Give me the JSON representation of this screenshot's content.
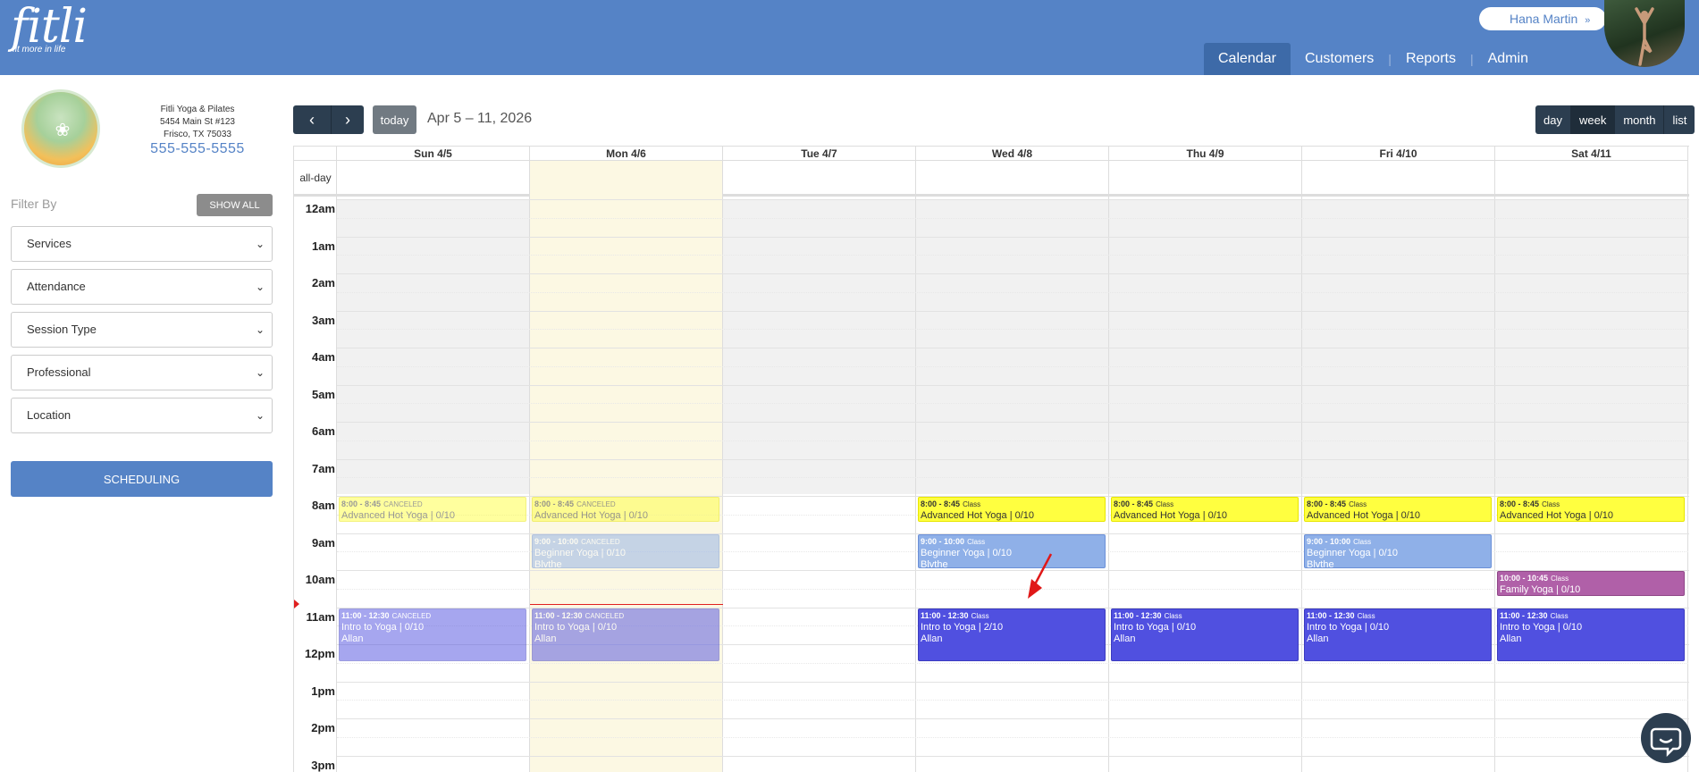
{
  "brand": {
    "logo": "fitli",
    "tagline": "fit more in life"
  },
  "user": {
    "name": "Hana Martin"
  },
  "nav": {
    "calendar": "Calendar",
    "customers": "Customers",
    "reports": "Reports",
    "admin": "Admin",
    "sep": "|"
  },
  "studio": {
    "name": "Fitli Yoga & Pilates",
    "address1": "5454 Main St #123",
    "address2": "Frisco, TX 75033",
    "phone": "555-555-5555"
  },
  "filters": {
    "label": "Filter By",
    "show_all": "SHOW ALL",
    "selects": [
      "Services",
      "Attendance",
      "Session Type",
      "Professional",
      "Location"
    ],
    "scheduling": "SCHEDULING"
  },
  "toolbar": {
    "prev": "‹",
    "next": "›",
    "today": "today",
    "range": "Apr 5 – 11, 2026",
    "views": [
      "day",
      "week",
      "month",
      "list"
    ],
    "active_view": "week"
  },
  "calendar": {
    "allday_label": "all-day",
    "days": [
      "Sun 4/5",
      "Mon 4/6",
      "Tue 4/7",
      "Wed 4/8",
      "Thu 4/9",
      "Fri 4/10",
      "Sat 4/11"
    ],
    "today_index": 1,
    "hours": [
      "12am",
      "1am",
      "2am",
      "3am",
      "4am",
      "5am",
      "6am",
      "7am",
      "8am",
      "9am",
      "10am",
      "11am",
      "12pm",
      "1pm",
      "2pm",
      "3pm"
    ],
    "events": [
      {
        "day": 0,
        "start": 8,
        "end": 8.75,
        "time": "8:00 - 8:45",
        "tag": "CANCELED",
        "title": "Advanced Hot Yoga | 0/10",
        "instructor": "",
        "color": "yellow",
        "canceled": true
      },
      {
        "day": 1,
        "start": 8,
        "end": 8.75,
        "time": "8:00 - 8:45",
        "tag": "CANCELED",
        "title": "Advanced Hot Yoga | 0/10",
        "instructor": "",
        "color": "yellow",
        "canceled": true
      },
      {
        "day": 3,
        "start": 8,
        "end": 8.75,
        "time": "8:00 - 8:45",
        "tag": "Class",
        "title": "Advanced Hot Yoga | 0/10",
        "instructor": "",
        "color": "yellow",
        "canceled": false
      },
      {
        "day": 4,
        "start": 8,
        "end": 8.75,
        "time": "8:00 - 8:45",
        "tag": "Class",
        "title": "Advanced Hot Yoga | 0/10",
        "instructor": "",
        "color": "yellow",
        "canceled": false
      },
      {
        "day": 5,
        "start": 8,
        "end": 8.75,
        "time": "8:00 - 8:45",
        "tag": "Class",
        "title": "Advanced Hot Yoga | 0/10",
        "instructor": "",
        "color": "yellow",
        "canceled": false
      },
      {
        "day": 6,
        "start": 8,
        "end": 8.75,
        "time": "8:00 - 8:45",
        "tag": "Class",
        "title": "Advanced Hot Yoga | 0/10",
        "instructor": "",
        "color": "yellow",
        "canceled": false
      },
      {
        "day": 1,
        "start": 9,
        "end": 10,
        "time": "9:00 - 10:00",
        "tag": "CANCELED",
        "title": "Beginner Yoga | 0/10",
        "instructor": "Blythe",
        "color": "blue",
        "canceled": true
      },
      {
        "day": 3,
        "start": 9,
        "end": 10,
        "time": "9:00 - 10:00",
        "tag": "Class",
        "title": "Beginner Yoga | 0/10",
        "instructor": "Blythe",
        "color": "blue",
        "canceled": false
      },
      {
        "day": 5,
        "start": 9,
        "end": 10,
        "time": "9:00 - 10:00",
        "tag": "Class",
        "title": "Beginner Yoga | 0/10",
        "instructor": "Blythe",
        "color": "blue",
        "canceled": false
      },
      {
        "day": 6,
        "start": 10,
        "end": 10.75,
        "time": "10:00 - 10:45",
        "tag": "Class",
        "title": "Family Yoga | 0/10",
        "instructor": "",
        "color": "mauve",
        "canceled": false
      },
      {
        "day": 0,
        "start": 11,
        "end": 12.5,
        "time": "11:00 - 12:30",
        "tag": "CANCELED",
        "title": "Intro to Yoga | 0/10",
        "instructor": "Allan",
        "color": "purple",
        "canceled": true
      },
      {
        "day": 1,
        "start": 11,
        "end": 12.5,
        "time": "11:00 - 12:30",
        "tag": "CANCELED",
        "title": "Intro to Yoga | 0/10",
        "instructor": "Allan",
        "color": "purple",
        "canceled": true
      },
      {
        "day": 3,
        "start": 11,
        "end": 12.5,
        "time": "11:00 - 12:30",
        "tag": "Class",
        "title": "Intro to Yoga | 2/10",
        "instructor": "Allan",
        "color": "purple",
        "canceled": false
      },
      {
        "day": 4,
        "start": 11,
        "end": 12.5,
        "time": "11:00 - 12:30",
        "tag": "Class",
        "title": "Intro to Yoga | 0/10",
        "instructor": "Allan",
        "color": "purple",
        "canceled": false
      },
      {
        "day": 5,
        "start": 11,
        "end": 12.5,
        "time": "11:00 - 12:30",
        "tag": "Class",
        "title": "Intro to Yoga | 0/10",
        "instructor": "Allan",
        "color": "purple",
        "canceled": false
      },
      {
        "day": 6,
        "start": 11,
        "end": 12.5,
        "time": "11:00 - 12:30",
        "tag": "Class",
        "title": "Intro to Yoga | 0/10",
        "instructor": "Allan",
        "color": "purple",
        "canceled": false
      }
    ]
  },
  "colors": {
    "header": "#5583c6",
    "toolbar": "#2c3e50",
    "today_bg": "#fcf8e3"
  }
}
